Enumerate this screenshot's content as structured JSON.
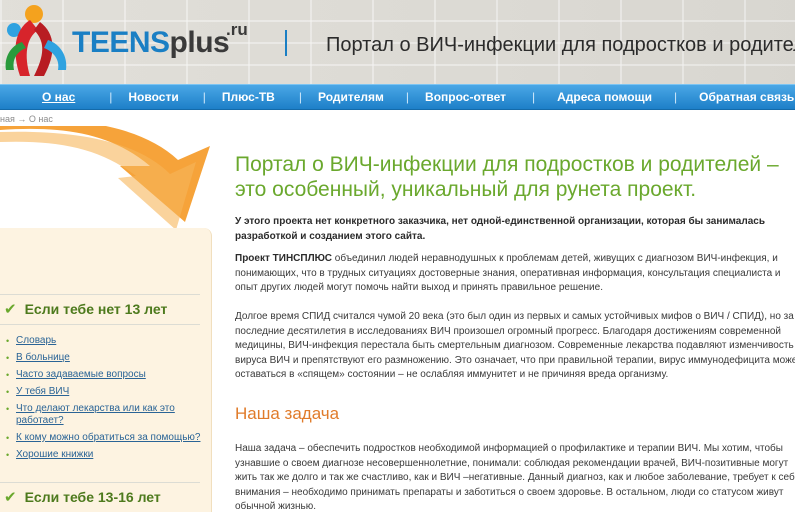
{
  "header": {
    "logo_main": "TEENS",
    "logo_accent": "plus",
    "logo_tld": ".ru",
    "title": "Портал о ВИЧ-инфекции для подростков и родителе"
  },
  "nav": {
    "items": [
      {
        "label": "О нас",
        "active": true
      },
      {
        "label": "Новости"
      },
      {
        "label": "Плюс-ТВ"
      },
      {
        "label": "Родителям"
      },
      {
        "label": "Вопрос-ответ"
      },
      {
        "label": "Адреса помощи"
      },
      {
        "label": "Обратная связь"
      }
    ],
    "separator": "|"
  },
  "breadcrumb": "ная → О нас",
  "sidebar": {
    "section1_title": "Если тебе нет 13 лет",
    "section2_title": "Если тебе 13-16 лет",
    "links": [
      "Словарь",
      "В больнице",
      "Часто задаваемые вопросы",
      "У тебя ВИЧ",
      "Что делают лекарства или как это работает?",
      "К кому можно обратиться за помощью?",
      "Хорошие книжки"
    ]
  },
  "main": {
    "title": "Портал о ВИЧ-инфекции для подростков и родителей – это особенный, уникальный для рунета проект.",
    "intro": "У этого проекта нет конкретного заказчика, нет одной-единственной организации, которая бы занималась разработкой и созданием этого сайта.",
    "p1_lead": "Проект ТИНСПЛЮС",
    "p1_rest": " объединил людей неравнодушных к проблемам детей, живущих с диагнозом ВИЧ-инфекция, и понимающих, что в трудных ситуациях достоверные знания, оперативная информация, консультация специалиста и опыт других людей могут помочь найти выход и принять правильное решение.",
    "p2": "Долгое время СПИД считался чумой 20 века (это был один из первых и самых устойчивых мифов о ВИЧ / СПИД), но за последние десятилетия в исследованиях ВИЧ произошел огромный прогресс. Благодаря достижениям современной медицины, ВИЧ-инфекция перестала быть смертельным диагнозом. Современные лекарства подавляют изменчивость вируса ВИЧ и препятствуют его размножению. Это означает, что при правильной терапии, вирус иммунодефицита может оставаться в «спящем» состоянии – не ослабляя иммунитет и не причиняя вреда организму.",
    "task_heading": "Наша задача",
    "p3": "Наша задача – обеспечить подростков необходимой информацией о профилактике и терапии ВИЧ. Мы хотим, чтобы узнавшие о своем диагнозе несовершеннолетние, понимали: соблюдая рекомендации врачей, ВИЧ-позитивные могут жить так же долго и так же счастливо, как и ВИЧ –негативные. Данный диагноз, как и любое заболевание, требует к себе внимания – необходимо принимать препараты и заботиться о своем здоровье. В остальном, люди со статусом живут обычной жизнью."
  },
  "colors": {
    "nav_blue": "#1d7fc8",
    "title_green": "#6aa82d",
    "heading_orange": "#e07b2a",
    "link_blue": "#2a6496"
  }
}
